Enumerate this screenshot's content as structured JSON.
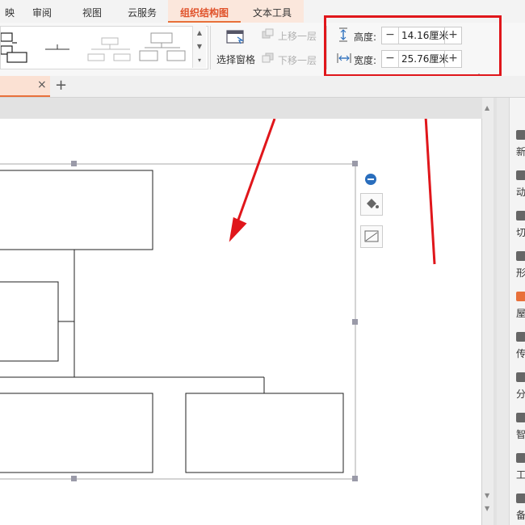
{
  "menu_tabs": [
    {
      "label": "映"
    },
    {
      "label": "审阅"
    },
    {
      "label": "视图"
    },
    {
      "label": "云服务"
    },
    {
      "label": "组织结构图"
    },
    {
      "label": "文本工具"
    }
  ],
  "ribbon": {
    "select_pane_label": "选择窗格",
    "move_up_label": "上移一层",
    "move_down_label": "下移一层",
    "height_label": "高度:",
    "height_value": "14.16厘米",
    "width_label": "宽度:",
    "width_value": "25.76厘米",
    "minus": "−",
    "plus": "+"
  },
  "tabbar": {
    "close_glyph": "×",
    "add_glyph": "+"
  },
  "right_panel": [
    {
      "label": "新"
    },
    {
      "label": "动"
    },
    {
      "label": "切"
    },
    {
      "label": "形"
    },
    {
      "label": "屋"
    },
    {
      "label": "传"
    },
    {
      "label": "分"
    },
    {
      "label": "智"
    },
    {
      "label": "工"
    },
    {
      "label": "备"
    }
  ],
  "colors": {
    "accent": "#e8703a",
    "annotation_red": "#e0161b"
  }
}
